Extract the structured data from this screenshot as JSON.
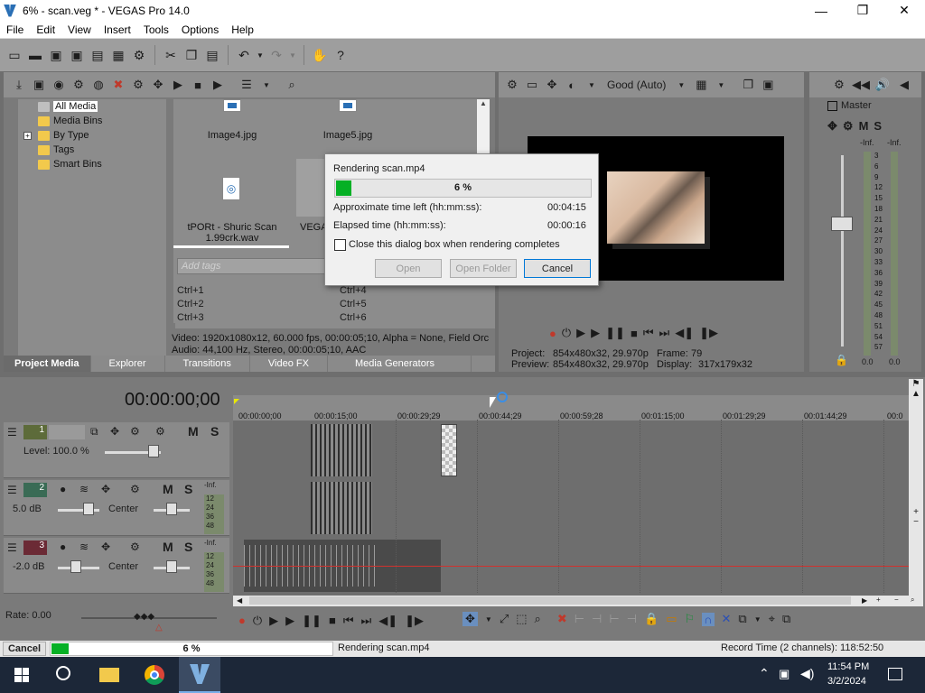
{
  "window": {
    "title": "6% - scan.veg * - VEGAS Pro 14.0",
    "minimize": "—",
    "maximize": "❐",
    "close": "✕"
  },
  "menu": [
    "File",
    "Edit",
    "View",
    "Insert",
    "Tools",
    "Options",
    "Help"
  ],
  "project_media": {
    "tree": [
      "All Media",
      "Media Bins",
      "By Type",
      "Tags",
      "Smart Bins"
    ],
    "expand_glyph": "+",
    "thumbs": [
      "Image4.jpg",
      "Image5.jpg",
      "tPORt - Shuric Scan 1.99crk.wav",
      "VEGA"
    ],
    "tags_placeholder": "Add tags",
    "shortcuts": [
      "Ctrl+1",
      "Ctrl+2",
      "Ctrl+3",
      "Ctrl+4",
      "Ctrl+5",
      "Ctrl+6"
    ],
    "info_video": "Video: 1920x1080x12, 60.000 fps, 00:00:05;10, Alpha = None, Field Orc",
    "info_audio": "Audio: 44,100 Hz, Stereo, 00:00:05;10, AAC",
    "tabs": [
      "Project Media",
      "Explorer",
      "Transitions",
      "Video FX",
      "Media Generators"
    ]
  },
  "preview": {
    "quality": "Good (Auto)",
    "project_label": "Project:",
    "project_value": "854x480x32, 29.970p",
    "frame_label": "Frame:",
    "frame_value": "79",
    "preview_label": "Preview:",
    "preview_value": "854x480x32, 29.970p",
    "display_label": "Display:",
    "display_value": "317x179x32"
  },
  "master": {
    "label": "Master",
    "m": "M",
    "s": "S",
    "inf_l": "-Inf.",
    "inf_r": "-Inf.",
    "scale": [
      "3",
      "6",
      "9",
      "12",
      "15",
      "18",
      "21",
      "24",
      "27",
      "30",
      "33",
      "36",
      "39",
      "42",
      "45",
      "48",
      "51",
      "54",
      "57"
    ],
    "bottom_l": "0.0",
    "bottom_r": "0.0"
  },
  "render_dialog": {
    "title": "Rendering scan.mp4",
    "progress_text": "6 %",
    "progress": 0.06,
    "time_left_label": "Approximate time left (hh:mm:ss):",
    "time_left": "00:04:15",
    "elapsed_label": "Elapsed time (hh:mm:ss):",
    "elapsed": "00:00:16",
    "close_checkbox": "Close this dialog box when rendering completes",
    "open": "Open",
    "open_folder": "Open Folder",
    "cancel": "Cancel"
  },
  "timeline": {
    "timecode": "00:00:00;00",
    "ruler": [
      "00:00:00;00",
      "00:00:15;00",
      "00:00:29;29",
      "00:00:44;29",
      "00:00:59;28",
      "00:01:15;00",
      "00:01:29;29",
      "00:01:44;29",
      "00:0"
    ],
    "tracks": [
      {
        "num": "1",
        "m": "M",
        "s": "S",
        "level": "Level: 100.0 %"
      },
      {
        "num": "2",
        "m": "M",
        "s": "S",
        "db": "5.0 dB",
        "pan": "Center",
        "meter": [
          "-Inf.",
          "12",
          "24",
          "36",
          "48"
        ]
      },
      {
        "num": "3",
        "m": "M",
        "s": "S",
        "db": "-2.0 dB",
        "pan": "Center",
        "meter": [
          "-Inf.",
          "12",
          "24",
          "36",
          "48"
        ]
      }
    ],
    "rate": "Rate: 0.00"
  },
  "statusbar": {
    "cancel": "Cancel",
    "progress_text": "6 %",
    "progress": 0.06,
    "message": "Rendering scan.mp4",
    "record_time": "Record Time (2 channels): 118:52:50"
  },
  "taskbar": {
    "time": "11:54 PM",
    "date": "3/2/2024"
  }
}
